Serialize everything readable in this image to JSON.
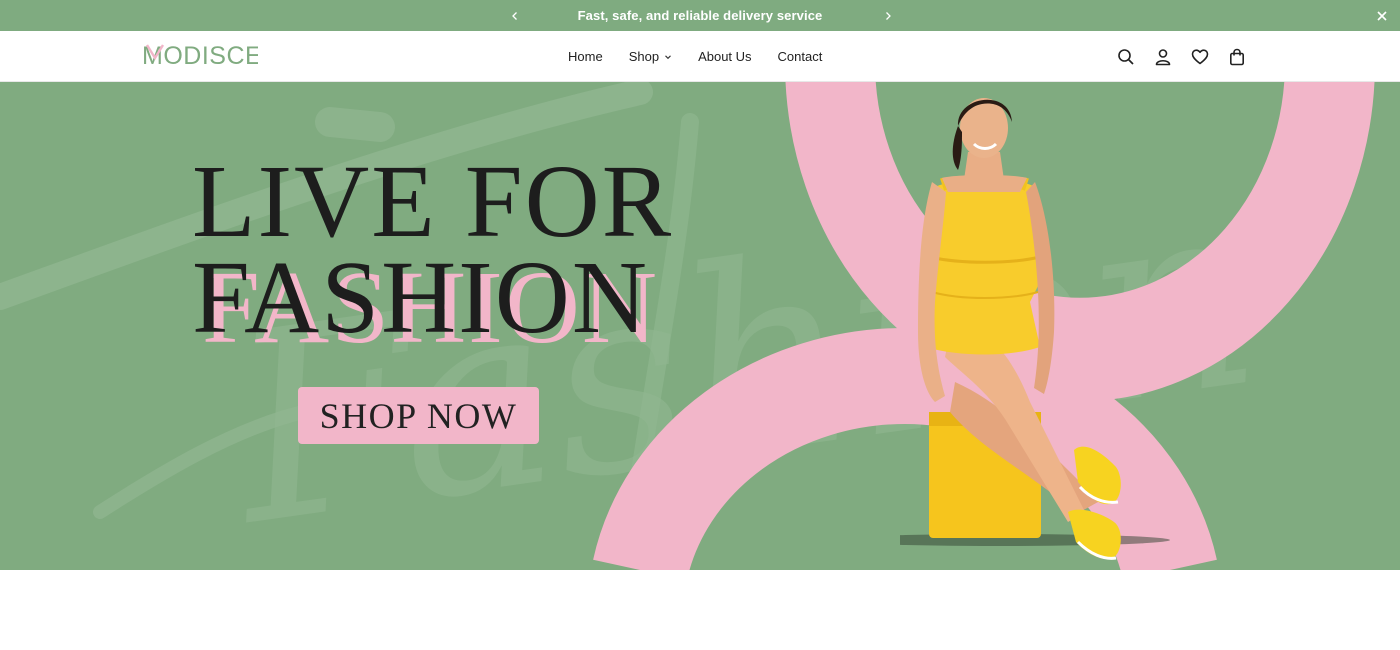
{
  "announcement": {
    "message": "Fast, safe, and reliable delivery service",
    "prev_icon": "chevron-left-icon",
    "next_icon": "chevron-right-icon",
    "close_icon": "close-icon"
  },
  "header": {
    "logo_text": "MODISCE",
    "nav": [
      {
        "label": "Home"
      },
      {
        "label": "Shop",
        "has_dropdown": true
      },
      {
        "label": "About Us"
      },
      {
        "label": "Contact"
      }
    ],
    "icons": [
      "search-icon",
      "account-icon",
      "wishlist-icon",
      "cart-icon"
    ]
  },
  "hero": {
    "headline_line1": "LIVE FOR",
    "headline_line2": "FASHION",
    "background_script": "Fashion",
    "cta_label": "SHOP NOW"
  },
  "colors": {
    "brand_green": "#80ab80",
    "brand_pink": "#f2b6c9",
    "text_dark": "#1d1d1d",
    "dress_yellow": "#f8cc2c"
  }
}
